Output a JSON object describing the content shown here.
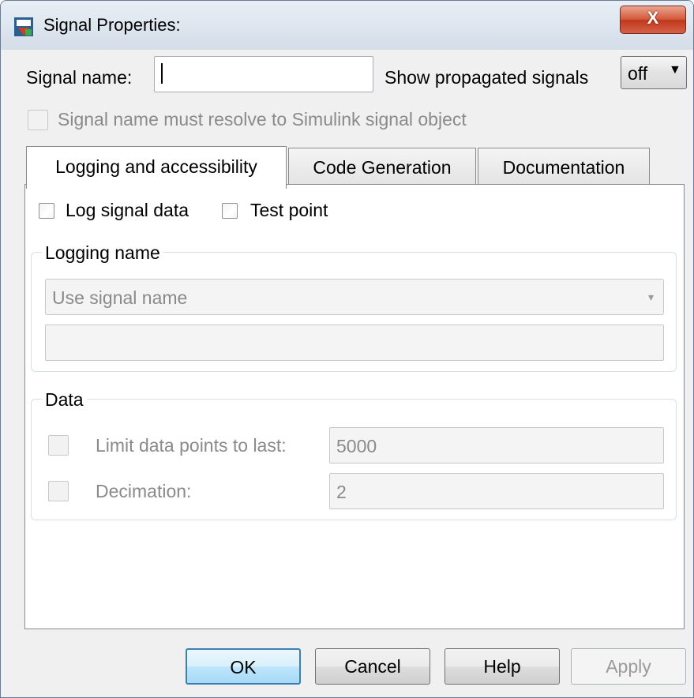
{
  "window": {
    "title": "Signal Properties:",
    "close_label": "X"
  },
  "signal_name": {
    "label": "Signal name:",
    "value": ""
  },
  "propagated": {
    "label": "Show propagated signals",
    "value": "off",
    "arrow": "▼"
  },
  "resolve_checkbox": {
    "label": "Signal name must resolve to Simulink signal object",
    "checked": false,
    "enabled": false
  },
  "tabs": [
    {
      "label": "Logging and accessibility",
      "active": true
    },
    {
      "label": "Code Generation",
      "active": false
    },
    {
      "label": "Documentation",
      "active": false
    }
  ],
  "logging": {
    "log_signal_label": "Log signal data",
    "test_point_label": "Test point",
    "logging_name_group": "Logging name",
    "logging_name_mode": "Use signal name",
    "logging_name_arrow": "▾",
    "logging_name_value": "",
    "data_group": "Data",
    "limit_label": "Limit data points to last:",
    "limit_value": "5000",
    "decimation_label": "Decimation:",
    "decimation_value": "2"
  },
  "buttons": {
    "ok": "OK",
    "cancel": "Cancel",
    "help": "Help",
    "apply": "Apply"
  },
  "colors": {
    "default_button_border": "#3c7fb1",
    "close_button": "#c0391b",
    "disabled_text": "#8a8a8a"
  }
}
